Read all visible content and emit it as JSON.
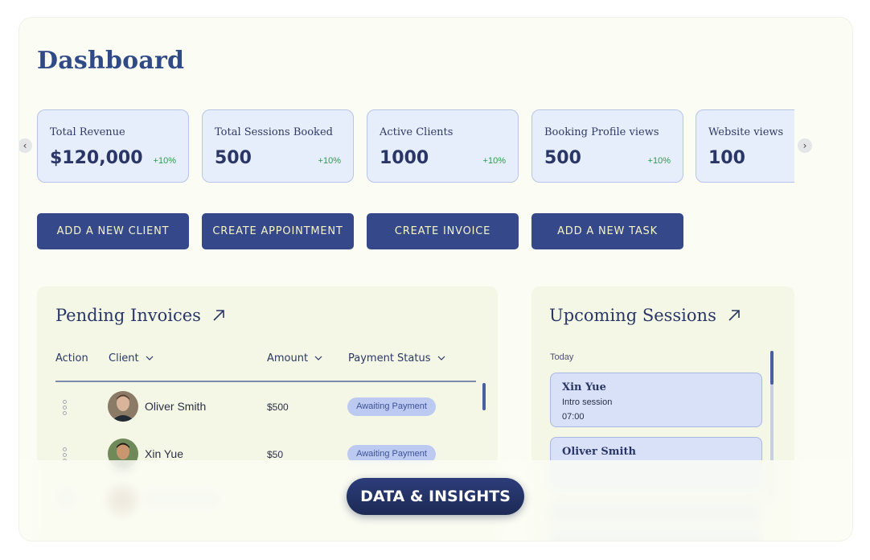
{
  "page": {
    "title": "Dashboard"
  },
  "stats": [
    {
      "label": "Total Revenue",
      "value": "$120,000",
      "change": "+10%"
    },
    {
      "label": "Total Sessions Booked",
      "value": "500",
      "change": "+10%"
    },
    {
      "label": "Active Clients",
      "value": "1000",
      "change": "+10%"
    },
    {
      "label": "Booking Profile views",
      "value": "500",
      "change": "+10%"
    },
    {
      "label": "Website views",
      "value": "100",
      "change": ""
    }
  ],
  "carousel": {
    "prev_icon": "chevron-left-icon",
    "next_icon": "chevron-right-icon",
    "prev_glyph": "‹",
    "next_glyph": "›"
  },
  "actions": [
    {
      "label": "ADD A NEW CLIENT"
    },
    {
      "label": "CREATE APPOINTMENT"
    },
    {
      "label": "CREATE INVOICE"
    },
    {
      "label": "ADD A NEW TASK"
    }
  ],
  "invoices": {
    "title": "Pending Invoices",
    "columns": [
      "Action",
      "Client",
      "Amount",
      "Payment Status"
    ],
    "rows": [
      {
        "client": "Oliver Smith",
        "amount": "$500",
        "status": "Awaiting Payment"
      },
      {
        "client": "Xin Yue",
        "amount": "$50",
        "status": "Awaiting Payment"
      }
    ]
  },
  "sessions": {
    "title": "Upcoming Sessions",
    "group": "Today",
    "items": [
      {
        "name": "Xin Yue",
        "type": "Intro session",
        "time": "07:00"
      },
      {
        "name": "Oliver Smith",
        "type": "",
        "time": ""
      }
    ]
  },
  "banner": {
    "label": "DATA & INSIGHTS"
  },
  "colors": {
    "accent": "#34488a",
    "button_text": "#f6f4c9",
    "change_positive": "#2e9b4f",
    "badge_bg": "#bccaf1",
    "panel_bg": "#f4f7e6"
  }
}
